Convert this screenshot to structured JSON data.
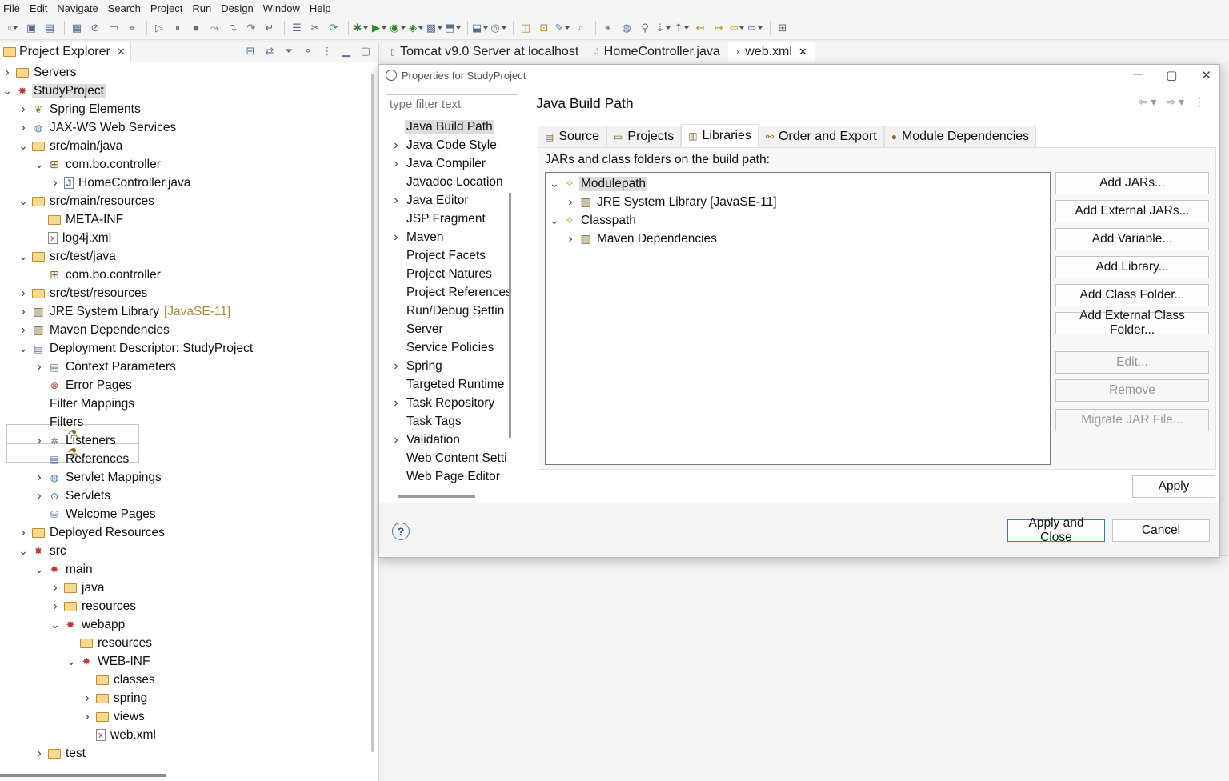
{
  "menu": [
    "File",
    "Edit",
    "Navigate",
    "Search",
    "Project",
    "Run",
    "Design",
    "Window",
    "Help"
  ],
  "explorer": {
    "tab_label": "Project Explorer",
    "close_glyph": "✕",
    "tree": [
      {
        "label": "Servers",
        "level": 0,
        "twisty": "collapsed",
        "icon": "folder",
        "name": "servers"
      },
      {
        "label": "StudyProject",
        "level": 0,
        "twisty": "expanded",
        "icon": "proj",
        "name": "study-project",
        "selected": true
      },
      {
        "label": "Spring Elements",
        "level": 1,
        "twisty": "collapsed",
        "icon": "leaf",
        "name": "spring-elements"
      },
      {
        "label": "JAX-WS Web Services",
        "level": 1,
        "twisty": "collapsed",
        "icon": "web",
        "name": "jax-ws"
      },
      {
        "label": "src/main/java",
        "level": 1,
        "twisty": "expanded",
        "icon": "folder",
        "name": "src-main-java"
      },
      {
        "label": "com.bo.controller",
        "level": 2,
        "twisty": "expanded",
        "icon": "pkg",
        "name": "package"
      },
      {
        "label": "HomeController.java",
        "level": 3,
        "twisty": "collapsed",
        "icon": "jfile",
        "name": "java-file"
      },
      {
        "label": "src/main/resources",
        "level": 1,
        "twisty": "expanded",
        "icon": "folder",
        "name": "src-main-resources"
      },
      {
        "label": "META-INF",
        "level": 2,
        "twisty": "none",
        "icon": "folder",
        "name": "meta-inf"
      },
      {
        "label": "log4j.xml",
        "level": 2,
        "twisty": "none",
        "icon": "xfile",
        "name": "xml-file"
      },
      {
        "label": "src/test/java",
        "level": 1,
        "twisty": "expanded",
        "icon": "folder",
        "name": "src-test-java"
      },
      {
        "label": "com.bo.controller",
        "level": 2,
        "twisty": "none",
        "icon": "pkg",
        "name": "package"
      },
      {
        "label": "src/test/resources",
        "level": 1,
        "twisty": "collapsed",
        "icon": "folder",
        "name": "src-test-resources"
      },
      {
        "label": "JRE System Library",
        "deco": "[JavaSE-11]",
        "level": 1,
        "twisty": "collapsed",
        "icon": "lib",
        "name": "jre-library"
      },
      {
        "label": "Maven Dependencies",
        "level": 1,
        "twisty": "collapsed",
        "icon": "lib",
        "name": "maven-deps"
      },
      {
        "label": "Deployment Descriptor: StudyProject",
        "level": 1,
        "twisty": "expanded",
        "icon": "deploy",
        "name": "deployment-descriptor"
      },
      {
        "label": "Context Parameters",
        "level": 2,
        "twisty": "collapsed",
        "icon": "deploy",
        "name": "context-params"
      },
      {
        "label": "Error Pages",
        "level": 2,
        "twisty": "none",
        "icon": "err",
        "name": "error-pages"
      },
      {
        "label": "Filter Mappings",
        "level": 2,
        "twisty": "none",
        "icon": "filter",
        "name": "filter-mappings"
      },
      {
        "label": "Filters",
        "level": 2,
        "twisty": "none",
        "icon": "filter",
        "name": "filters"
      },
      {
        "label": "Listeners",
        "level": 2,
        "twisty": "collapsed",
        "icon": "gear",
        "name": "listeners"
      },
      {
        "label": "References",
        "level": 2,
        "twisty": "none",
        "icon": "deploy",
        "name": "references"
      },
      {
        "label": "Servlet Mappings",
        "level": 2,
        "twisty": "collapsed",
        "icon": "web",
        "name": "servlet-mappings"
      },
      {
        "label": "Servlets",
        "level": 2,
        "twisty": "collapsed",
        "icon": "srv",
        "name": "servlets"
      },
      {
        "label": "Welcome Pages",
        "level": 2,
        "twisty": "none",
        "icon": "srvr",
        "name": "welcome-pages"
      },
      {
        "label": "Deployed Resources",
        "level": 1,
        "twisty": "collapsed",
        "icon": "folder",
        "name": "deployed-resources"
      },
      {
        "label": "src",
        "level": 1,
        "twisty": "expanded",
        "icon": "proj",
        "name": "src"
      },
      {
        "label": "main",
        "level": 2,
        "twisty": "expanded",
        "icon": "proj",
        "name": "main"
      },
      {
        "label": "java",
        "level": 3,
        "twisty": "collapsed",
        "icon": "folder",
        "name": "java"
      },
      {
        "label": "resources",
        "level": 3,
        "twisty": "collapsed",
        "icon": "folder",
        "name": "resources"
      },
      {
        "label": "webapp",
        "level": 3,
        "twisty": "expanded",
        "icon": "proj",
        "name": "webapp"
      },
      {
        "label": "resources",
        "level": 4,
        "twisty": "none",
        "icon": "folder",
        "name": "webapp-resources"
      },
      {
        "label": "WEB-INF",
        "level": 4,
        "twisty": "expanded",
        "icon": "proj",
        "name": "web-inf"
      },
      {
        "label": "classes",
        "level": 5,
        "twisty": "none",
        "icon": "folder",
        "name": "classes"
      },
      {
        "label": "spring",
        "level": 5,
        "twisty": "collapsed",
        "icon": "folder",
        "name": "spring"
      },
      {
        "label": "views",
        "level": 5,
        "twisty": "collapsed",
        "icon": "folder",
        "name": "views"
      },
      {
        "label": "web.xml",
        "level": 5,
        "twisty": "none",
        "icon": "xfile",
        "name": "web-xml"
      },
      {
        "label": "test",
        "level": 2,
        "twisty": "collapsed",
        "icon": "folder",
        "name": "test"
      },
      {
        "label": "target",
        "level": 1,
        "twisty": "expanded",
        "icon": "folder",
        "name": "target"
      }
    ]
  },
  "editor_tabs": [
    {
      "label": "Tomcat v9.0 Server at localhost",
      "icon": "▯"
    },
    {
      "label": "HomeController.java",
      "icon": "J"
    },
    {
      "label": "web.xml",
      "icon": "x",
      "active": true
    }
  ],
  "dialog": {
    "title": "Properties for StudyProject",
    "filter_placeholder": "type filter text",
    "categories": [
      {
        "label": "Java Build Path",
        "twisty": false,
        "selected": true
      },
      {
        "label": "Java Code Style",
        "twisty": true
      },
      {
        "label": "Java Compiler",
        "twisty": true
      },
      {
        "label": "Javadoc Location",
        "twisty": false
      },
      {
        "label": "Java Editor",
        "twisty": true
      },
      {
        "label": "JSP Fragment",
        "twisty": false
      },
      {
        "label": "Maven",
        "twisty": true
      },
      {
        "label": "Project Facets",
        "twisty": false
      },
      {
        "label": "Project Natures",
        "twisty": false
      },
      {
        "label": "Project References",
        "twisty": false
      },
      {
        "label": "Run/Debug Settin",
        "twisty": false
      },
      {
        "label": "Server",
        "twisty": false
      },
      {
        "label": "Service Policies",
        "twisty": false
      },
      {
        "label": "Spring",
        "twisty": true
      },
      {
        "label": "Targeted Runtime",
        "twisty": false
      },
      {
        "label": "Task Repository",
        "twisty": true
      },
      {
        "label": "Task Tags",
        "twisty": false
      },
      {
        "label": "Validation",
        "twisty": true
      },
      {
        "label": "Web Content Setti",
        "twisty": false
      },
      {
        "label": "Web Page Editor",
        "twisty": false
      }
    ],
    "page_title": "Java Build Path",
    "tabs": [
      {
        "label": "Source",
        "icon": "▤"
      },
      {
        "label": "Projects",
        "icon": "▭"
      },
      {
        "label": "Libraries",
        "icon": "▥",
        "active": true
      },
      {
        "label": "Order and Export",
        "icon": "⚯"
      },
      {
        "label": "Module Dependencies",
        "icon": "●"
      }
    ],
    "jars_label": "JARs and class folders on the build path:",
    "build_path": [
      {
        "label": "Modulepath",
        "level": 0,
        "twisty": "expanded",
        "icon": "mp",
        "selected": true
      },
      {
        "label": "JRE System Library [JavaSE-11]",
        "level": 1,
        "twisty": "collapsed",
        "icon": "lib"
      },
      {
        "label": "Classpath",
        "level": 0,
        "twisty": "expanded",
        "icon": "mp"
      },
      {
        "label": "Maven Dependencies",
        "level": 1,
        "twisty": "collapsed",
        "icon": "lib"
      }
    ],
    "buttons": {
      "add_jars": "Add JARs...",
      "add_external_jars": "Add External JARs...",
      "add_variable": "Add Variable...",
      "add_library": "Add Library...",
      "add_class_folder": "Add Class Folder...",
      "add_external_class_folder": "Add External Class Folder...",
      "edit": "Edit...",
      "remove": "Remove",
      "migrate": "Migrate JAR File...",
      "apply": "Apply",
      "apply_close": "Apply and Close",
      "cancel": "Cancel"
    }
  }
}
